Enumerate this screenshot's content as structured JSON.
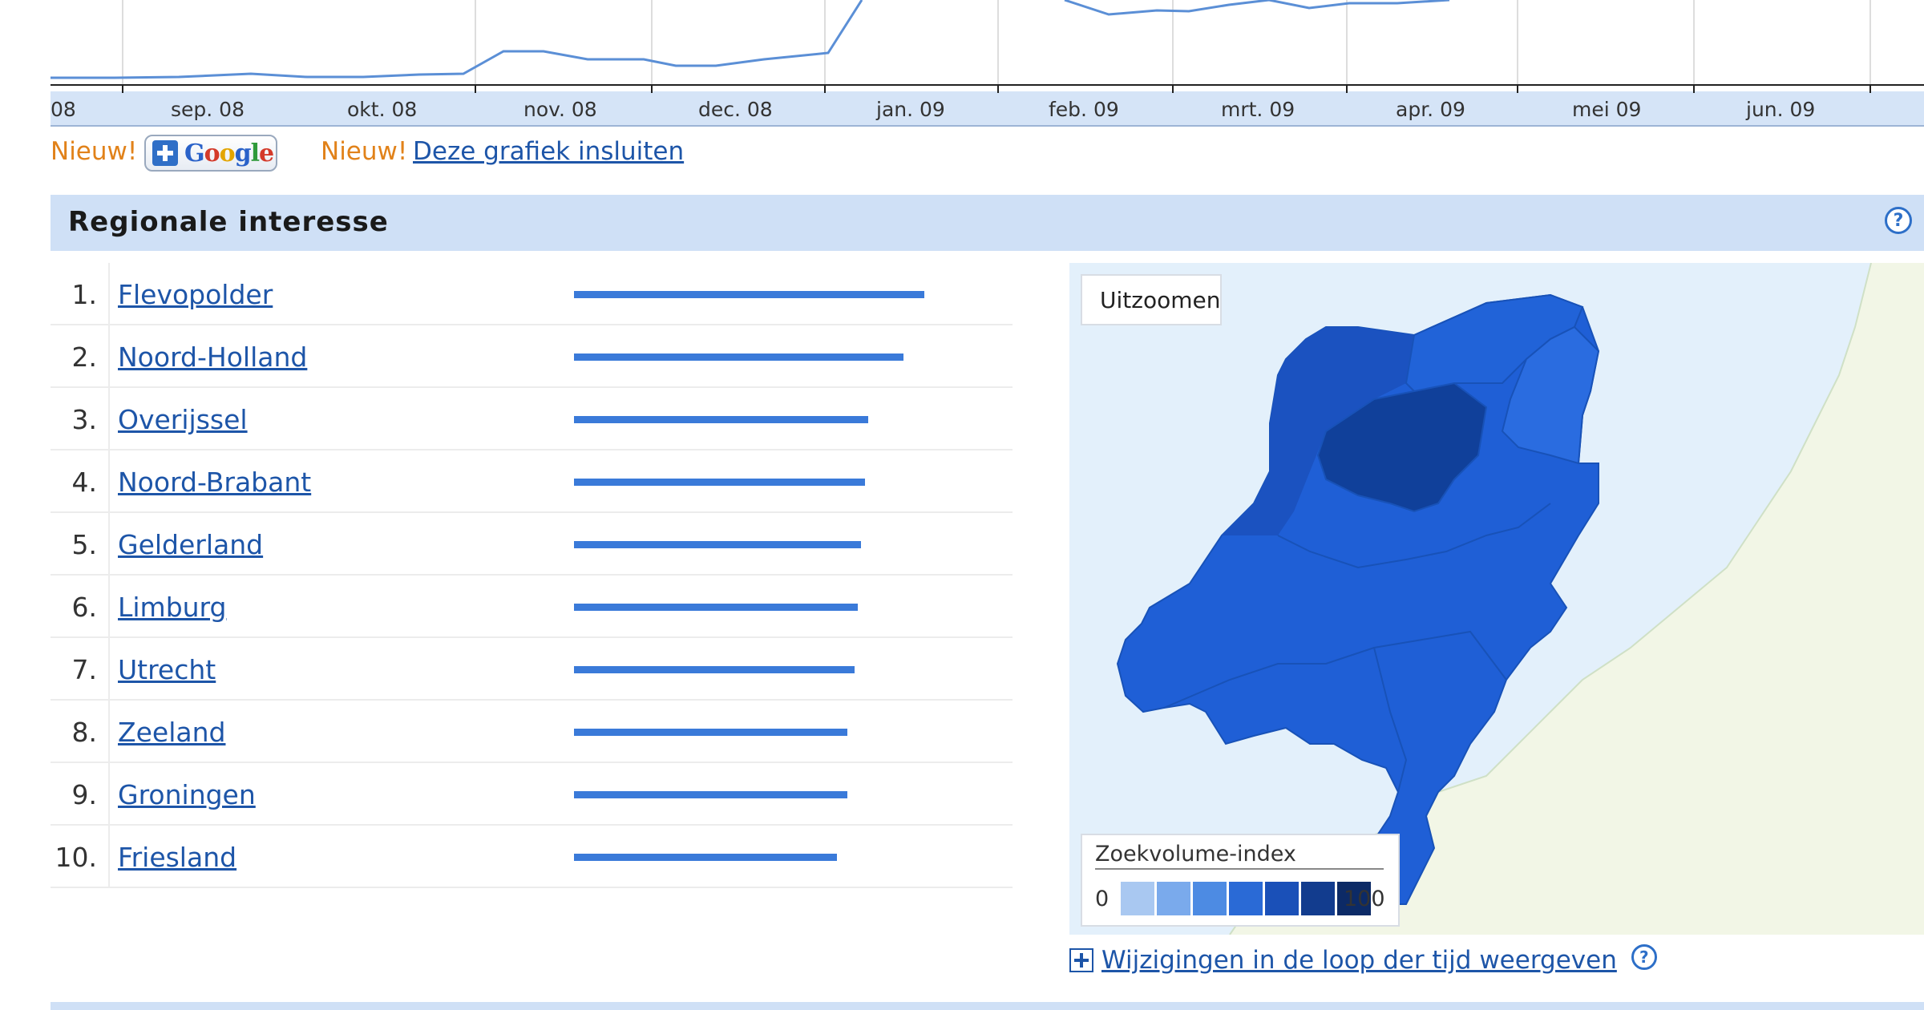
{
  "chart": {
    "month_labels": [
      "08",
      "sep. 08",
      "okt. 08",
      "nov. 08",
      "dec. 08",
      "jan. 09",
      "feb. 09",
      "mrt. 09",
      "apr. 09",
      "mei 09",
      "jun. 09"
    ],
    "colors": {
      "line": "#5b8fd6",
      "axis_band": "#d5e4f7",
      "grid": "#dddddd"
    }
  },
  "links_row": {
    "nieuw_1": "Nieuw!",
    "google_button_icon": "google-plus-icon",
    "nieuw_2": "Nieuw!",
    "embed_link": "Deze grafiek insluiten"
  },
  "regional": {
    "title": "Regionale interesse",
    "help_icon": "help-icon",
    "rows": [
      {
        "rank": "1.",
        "name": "Flevopolder",
        "value": 100
      },
      {
        "rank": "2.",
        "name": "Noord-Holland",
        "value": 94
      },
      {
        "rank": "3.",
        "name": "Overijssel",
        "value": 84
      },
      {
        "rank": "4.",
        "name": "Noord-Brabant",
        "value": 83
      },
      {
        "rank": "5.",
        "name": "Gelderland",
        "value": 82
      },
      {
        "rank": "6.",
        "name": "Limburg",
        "value": 81
      },
      {
        "rank": "7.",
        "name": "Utrecht",
        "value": 80
      },
      {
        "rank": "8.",
        "name": "Zeeland",
        "value": 78
      },
      {
        "rank": "9.",
        "name": "Groningen",
        "value": 78
      },
      {
        "rank": "10.",
        "name": "Friesland",
        "value": 75
      }
    ],
    "bar_color": "#3a7ad9"
  },
  "map": {
    "zoom_label": "Uitzoomen",
    "zoom_icon": "magnifier-icon",
    "legend_title": "Zoekvolume-index",
    "legend_min": "0",
    "legend_max": "100",
    "legend_colors": [
      "#a9c8f1",
      "#7aaaec",
      "#4d8be3",
      "#2a6ad6",
      "#1a50b8",
      "#123c8e",
      "#0c2a66"
    ],
    "colors": {
      "sea": "#e3f0fb",
      "land": "#f2f6e6",
      "nl_base": "#1f5fd6"
    }
  },
  "changes": {
    "label": "Wijzigingen in de loop der tijd weergeven",
    "expand_icon": "plus-box-icon",
    "help_icon": "help-icon"
  }
}
